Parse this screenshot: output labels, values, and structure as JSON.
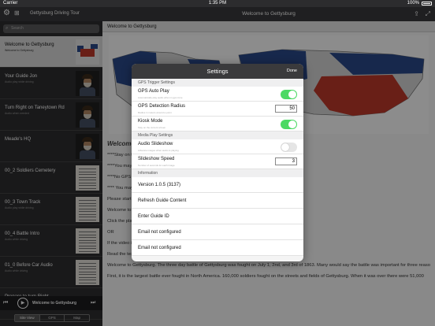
{
  "status_bar": {
    "carrier": "Carrier",
    "time": "1:35 PM",
    "battery": "100%"
  },
  "sidebar": {
    "title": "Gettysburg Driving Tour",
    "search_placeholder": "Search",
    "items": [
      {
        "title": "Welcome to Gettysburg",
        "subtitle": "Welcome to Gettysburg",
        "thumb": "map"
      },
      {
        "title": "Your Guide Jon",
        "subtitle": "Audio play while driving",
        "thumb": "person"
      },
      {
        "title": "Turn Right on Taneytown Rd",
        "subtitle": "Audio when needed",
        "thumb": "person"
      },
      {
        "title": "Meade's HQ",
        "subtitle": "",
        "thumb": "person"
      },
      {
        "title": "00_2 Soldiers Cemetery",
        "subtitle": "",
        "thumb": "doc"
      },
      {
        "title": "00_3 Town Track",
        "subtitle": "Audio play while driving",
        "thumb": "doc"
      },
      {
        "title": "00_4 Battle Intro",
        "subtitle": "Audio while driving",
        "thumb": "doc"
      },
      {
        "title": "01_0 Before Car Audio",
        "subtitle": "Audio while driving",
        "thumb": "doc"
      },
      {
        "title": "Prepare to turn Right",
        "subtitle": "",
        "thumb": "none"
      }
    ],
    "player": {
      "now_playing": "Welcome to Gettysburg"
    },
    "segments": [
      "Site View",
      "GPS",
      "Map"
    ]
  },
  "detail": {
    "nav_title": "Welcome to Gettysburg",
    "header": "Welcome to Gettysburg",
    "lines": [
      {
        "text": "Welcome",
        "heading": true
      },
      {
        "text": "****Stay on this page while the audio files are being downloaded****",
        "heading": false
      },
      {
        "text": "****You may continue to use the app while files are being downloaded****",
        "heading": false
      },
      {
        "text": "****No GPS is needed",
        "heading": false
      },
      {
        "text": "**** You may need to restart the app on iPad if app is not working right****",
        "heading": false
      },
      {
        "text": "Please start your tour",
        "heading": false
      },
      {
        "text": "Welcome to Gettysburg",
        "heading": false
      },
      {
        "text": "Click the play button above to watch the Video",
        "heading": false
      },
      {
        "text": "OR",
        "heading": false
      },
      {
        "text": "If the video is taking too long to load.",
        "heading": false
      },
      {
        "text": "Read the text below.",
        "heading": false
      },
      {
        "text": "Welcome to Gettysburg. The three day battle of Gettysburg was fought on July 1, 2nd, and 3rd of 1863. Many would say the battle was important for three reasons.",
        "heading": false
      },
      {
        "text": "First, it is the largest battle ever fought in North America. 160,000 soldiers fought on the streets and fields of Gettysburg. When it was over there were 51,000",
        "heading": false
      }
    ]
  },
  "settings": {
    "title": "Settings",
    "done_label": "Done",
    "gps_section": "GPS Trigger Settings",
    "gps_auto_play": {
      "label": "GPS Auto Play",
      "hint": "Automatically play audio when in gps zone",
      "on": true
    },
    "gps_radius": {
      "label": "GPS Detection Radius",
      "hint": "Radius in meters around a point",
      "value": "50"
    },
    "kiosk": {
      "label": "Kiosk Mode",
      "hint": "Stay on the current screen",
      "on": true
    },
    "media_section": "Media Play Settings",
    "audio_slideshow": {
      "label": "Audio Slideshow",
      "hint": "Advance images when audio is playing",
      "on": false
    },
    "slideshow_speed": {
      "label": "Slideshow Speed",
      "hint": "Number of seconds for each image",
      "value": "3"
    },
    "info_section": "Information",
    "info_items": [
      "Version 1.0.5 (3137)",
      "Refresh Guide Content",
      "Enter Guide ID",
      "Email not configured",
      "Email not configured"
    ]
  },
  "colors": {
    "toggle_on": "#4cd964",
    "nav_bg": "#3a3a3c",
    "union_blue": "#2b4a8b",
    "confederate_red": "#c0392b"
  }
}
